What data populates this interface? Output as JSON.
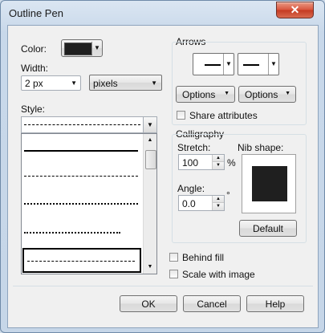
{
  "window": {
    "title": "Outline Pen",
    "close_symbol": "✕"
  },
  "color": {
    "label": "Color:",
    "swatch": "#1f1f1f"
  },
  "width": {
    "label": "Width:",
    "value": "2 px",
    "units": "pixels"
  },
  "style": {
    "label": "Style:"
  },
  "arrows": {
    "title": "Arrows",
    "options_left": "Options",
    "options_right": "Options",
    "share": "Share attributes"
  },
  "calligraphy": {
    "title": "Calligraphy",
    "stretch_label": "Stretch:",
    "stretch_value": "100",
    "stretch_unit": "%",
    "nib_label": "Nib shape:",
    "angle_label": "Angle:",
    "angle_value": "0.0",
    "angle_unit": "°",
    "default_button": "Default"
  },
  "behind_fill": "Behind fill",
  "scale_with_image": "Scale with image",
  "buttons": {
    "ok": "OK",
    "cancel": "Cancel",
    "help": "Help"
  },
  "icons": {
    "dropdown": "▼",
    "spin_up": "▲",
    "spin_down": "▼"
  }
}
